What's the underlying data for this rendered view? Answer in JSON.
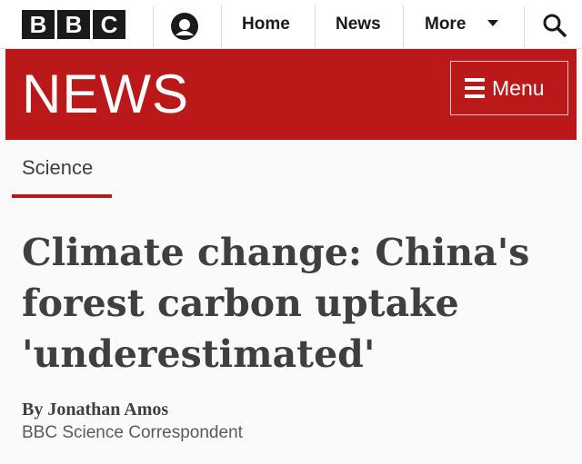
{
  "masthead": {
    "logo_letters": [
      "B",
      "B",
      "C"
    ],
    "account_icon": "user-account-icon",
    "nav": [
      {
        "label": "Home"
      },
      {
        "label": "News"
      },
      {
        "label": "More"
      }
    ],
    "more_icon": "chevron-down-icon",
    "search_icon": "search-icon"
  },
  "banner": {
    "title": "NEWS",
    "menu_label": "Menu",
    "menu_icon": "hamburger-menu-icon",
    "background_color": "#bb1919"
  },
  "article": {
    "section": "Science",
    "headline": "Climate change: China's forest carbon uptake 'underestimated'",
    "byline": {
      "author": "By Jonathan Amos",
      "role": "BBC Science Correspondent"
    }
  }
}
